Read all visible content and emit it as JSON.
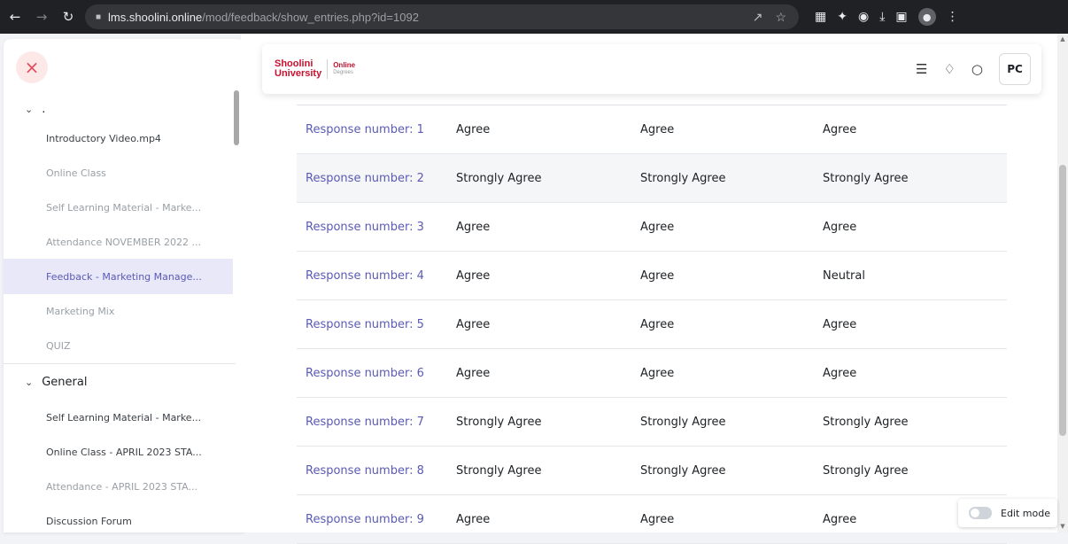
{
  "browser": {
    "url_host": "lms.shoolini.online",
    "url_path": "/mod/feedback/show_entries.php?id=1092"
  },
  "logo": {
    "university_line1": "Shoolini",
    "university_line2": "University",
    "online_line1": "Online",
    "online_line2": "Degrees"
  },
  "topbar": {
    "avatar_initials": "PC"
  },
  "drawer": {
    "section1_label": ".",
    "section1_items": [
      {
        "label": "Introductory Video.mp4",
        "state": "normal"
      },
      {
        "label": "Online Class",
        "state": "muted"
      },
      {
        "label": "Self Learning Material - Marke...",
        "state": "muted"
      },
      {
        "label": "Attendance NOVEMBER 2022 ...",
        "state": "muted"
      },
      {
        "label": "Feedback - Marketing Manage...",
        "state": "active"
      },
      {
        "label": "Marketing Mix",
        "state": "muted"
      },
      {
        "label": "QUIZ",
        "state": "muted"
      }
    ],
    "section2_label": "General",
    "section2_items": [
      {
        "label": "Self Learning Material - Marke...",
        "state": "normal"
      },
      {
        "label": "Online Class - APRIL 2023 STA...",
        "state": "normal"
      },
      {
        "label": "Attendance - APRIL 2023 STA...",
        "state": "muted"
      },
      {
        "label": "Discussion Forum",
        "state": "normal"
      }
    ]
  },
  "responses": [
    [
      "Response number: 1",
      "Agree",
      "Agree",
      "Agree"
    ],
    [
      "Response number: 2",
      "Strongly Agree",
      "Strongly Agree",
      "Strongly Agree"
    ],
    [
      "Response number: 3",
      "Agree",
      "Agree",
      "Agree"
    ],
    [
      "Response number: 4",
      "Agree",
      "Agree",
      "Neutral"
    ],
    [
      "Response number: 5",
      "Agree",
      "Agree",
      "Agree"
    ],
    [
      "Response number: 6",
      "Agree",
      "Agree",
      "Agree"
    ],
    [
      "Response number: 7",
      "Strongly Agree",
      "Strongly Agree",
      "Strongly Agree"
    ],
    [
      "Response number: 8",
      "Strongly Agree",
      "Strongly Agree",
      "Strongly Agree"
    ],
    [
      "Response number: 9",
      "Agree",
      "Agree",
      "Agree"
    ]
  ],
  "edit_mode": {
    "label": "Edit mode",
    "enabled": false
  },
  "colors": {
    "accent": "#5a5ab6",
    "brand": "#c8102e",
    "active_bg": "#e8e8f9"
  }
}
